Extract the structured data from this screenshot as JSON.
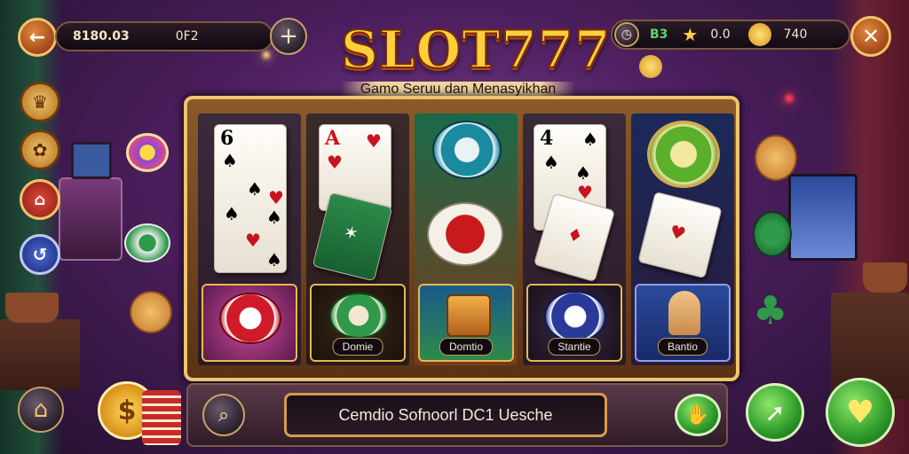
{
  "header": {
    "back_icon": "arrow-left-icon",
    "balance": "8180.03",
    "secondary_value": "0F2",
    "add_icon": "plus-icon",
    "stat1_icon": "clock-icon",
    "stat1_value": "B3",
    "stat2_icon": "star-icon",
    "stat2_value": "0.0",
    "coins_icon": "coin-icon",
    "coins_value": "740",
    "close_icon": "close-x-icon"
  },
  "logo": {
    "title": "SLOT777",
    "subtitle": "Gamo Seruu dan Menasyikhan"
  },
  "reels": [
    {
      "top_card_rank": "6",
      "label": "Domie"
    },
    {
      "top_card_rank": "A",
      "label": "Domtio"
    },
    {
      "top_card_rank": "",
      "label": "Stantie"
    },
    {
      "top_card_rank": "4",
      "label": "Bantio"
    },
    {
      "top_card_rank": "",
      "label": "Bantio"
    }
  ],
  "reel_labels": [
    "Domie",
    "Domtio",
    "Stantie",
    "Bantio"
  ],
  "side_icons": [
    "crown-icon",
    "badge-icon",
    "gift-icon",
    "swirl-icon"
  ],
  "bottom": {
    "home_icon": "home-icon",
    "dollar_icon": "dollar-coin-icon",
    "search_icon": "magnifier-icon",
    "message": "Cemdio Sofnoorl DC1 Uesche",
    "action1_icon": "hand-icon",
    "action2_icon": "arrow-swoosh-icon",
    "action3_icon": "heart-icon"
  },
  "colors": {
    "gold": "#f0c46a",
    "accent_orange": "#c2561e",
    "green": "#2e9a2a"
  }
}
